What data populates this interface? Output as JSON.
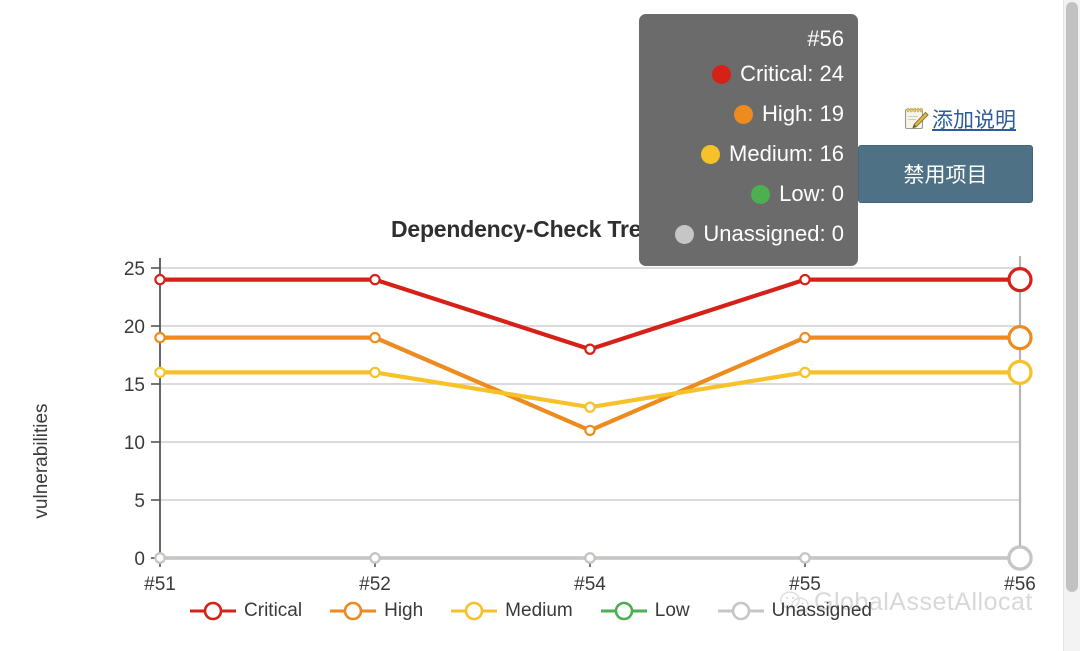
{
  "chart_data": {
    "type": "line",
    "title": "Dependency-Check Trend",
    "xlabel": "",
    "ylabel": "vulnerabilities",
    "categories": [
      "#51",
      "#52",
      "#54",
      "#55",
      "#56"
    ],
    "yticks": [
      0,
      5,
      10,
      15,
      20,
      25
    ],
    "ylim": [
      0,
      25
    ],
    "grid": true,
    "legend_position": "bottom",
    "series": [
      {
        "name": "Critical",
        "color": "#d62118",
        "values": [
          24,
          24,
          18,
          24,
          24
        ]
      },
      {
        "name": "High",
        "color": "#ed8b1f",
        "values": [
          19,
          19,
          11,
          19,
          19
        ]
      },
      {
        "name": "Medium",
        "color": "#f7c12a",
        "values": [
          16,
          16,
          13,
          16,
          16
        ]
      },
      {
        "name": "Low",
        "color": "#4caf50",
        "values": [
          0,
          0,
          0,
          0,
          0
        ]
      },
      {
        "name": "Unassigned",
        "color": "#c6c6c6",
        "values": [
          0,
          0,
          0,
          0,
          0
        ]
      }
    ],
    "highlighted_category": "#56"
  },
  "tooltip": {
    "build": "#56",
    "rows": [
      {
        "label": "Critical: 24",
        "color": "#d62118"
      },
      {
        "label": "High: 19",
        "color": "#ed8b1f"
      },
      {
        "label": "Medium: 16",
        "color": "#f7c12a"
      },
      {
        "label": "Low: 0",
        "color": "#4caf50"
      },
      {
        "label": "Unassigned: 0",
        "color": "#c6c6c6"
      }
    ],
    "background": "#6b6b6b"
  },
  "actions": {
    "add_description_label": "添加说明",
    "disable_project_label": "禁用项目",
    "button_color": "#4e7186",
    "link_color": "#2b5c9b"
  },
  "watermark": {
    "text": "GlobalAssetAllocat"
  }
}
